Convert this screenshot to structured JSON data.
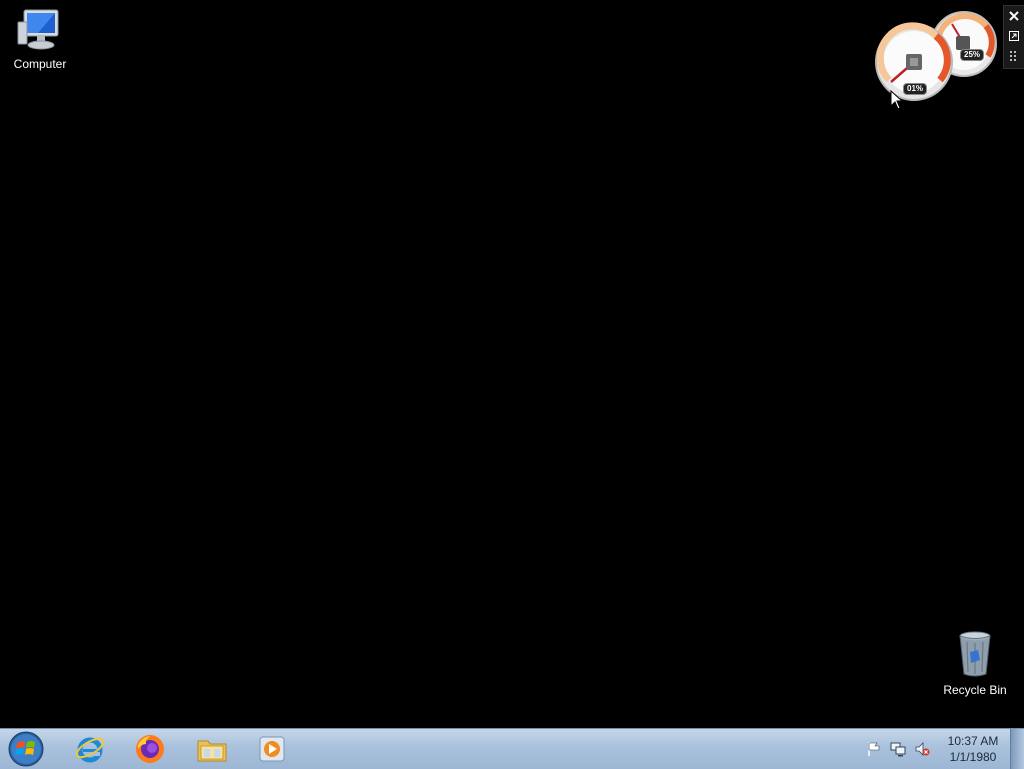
{
  "desktop": {
    "icons": [
      {
        "label": "Computer",
        "icon": "computer-icon"
      },
      {
        "label": "Recycle Bin",
        "icon": "recycle-bin-icon"
      }
    ]
  },
  "gadget": {
    "name": "cpu-meter",
    "cpu_usage": "01%",
    "memory_usage": "25%",
    "cpu_fraction": 0.01,
    "memory_fraction": 0.25
  },
  "taskbar": {
    "items": [
      {
        "icon": "windows-start-icon"
      },
      {
        "icon": "internet-explorer-icon"
      },
      {
        "icon": "firefox-icon"
      },
      {
        "icon": "file-explorer-icon"
      },
      {
        "icon": "media-player-icon"
      }
    ],
    "tray": {
      "icons": [
        "action-center-flag-icon",
        "network-icon",
        "volume-muted-icon"
      ],
      "time": "10:37 AM",
      "date": "1/1/1980"
    }
  },
  "colors": {
    "desktop_background": "#000000",
    "taskbar_top": "#c5d6e8",
    "taskbar_bottom": "#9db6d3"
  }
}
